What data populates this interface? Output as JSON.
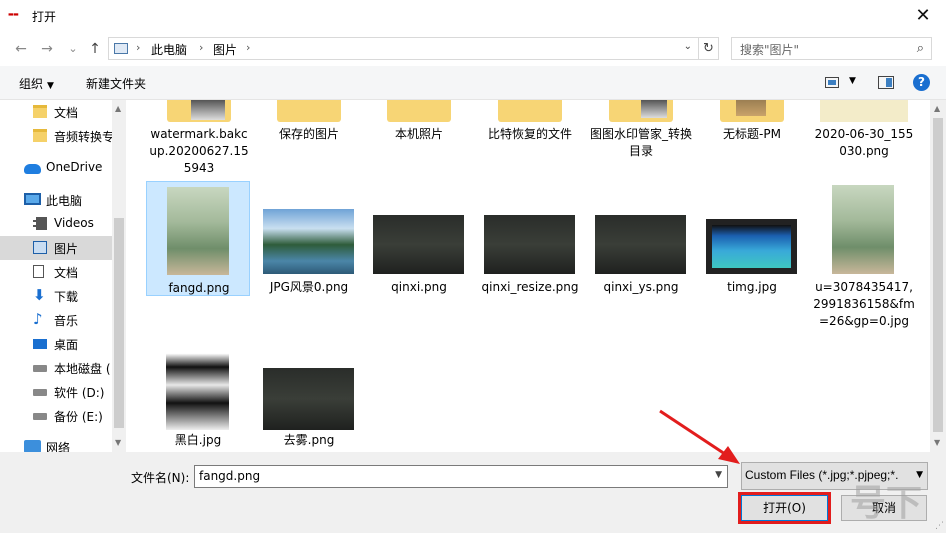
{
  "window": {
    "title": "打开",
    "close_glyph": "✕"
  },
  "nav": {
    "back": "←",
    "forward": "→",
    "recent": "⌄",
    "up": "↑",
    "path": [
      "此电脑",
      "图片"
    ],
    "sep": "›",
    "search_placeholder": "搜索\"图片\""
  },
  "toolbar": {
    "organize": "组织",
    "new_folder": "新建文件夹"
  },
  "sidebar": {
    "items": [
      {
        "label": "文档",
        "icon": "folder-icon"
      },
      {
        "label": "音频转换专",
        "icon": "folder-icon"
      },
      {
        "label": "OneDrive",
        "icon": "onedrive-icon"
      },
      {
        "label": "此电脑",
        "icon": "this-pc-icon"
      },
      {
        "label": "Videos",
        "icon": "videos-icon"
      },
      {
        "label": "图片",
        "icon": "pictures-icon",
        "selected": true
      },
      {
        "label": "文档",
        "icon": "documents-icon"
      },
      {
        "label": "下载",
        "icon": "downloads-icon"
      },
      {
        "label": "音乐",
        "icon": "music-icon"
      },
      {
        "label": "桌面",
        "icon": "desktop-icon"
      },
      {
        "label": "本地磁盘 (",
        "icon": "local-disk-icon"
      },
      {
        "label": "软件 (D:)",
        "icon": "drive-icon"
      },
      {
        "label": "备份 (E:)",
        "icon": "drive-icon"
      },
      {
        "label": "网络",
        "icon": "network-icon"
      }
    ]
  },
  "files": [
    {
      "name": "watermark.bakcup.20200627.155943",
      "kind": "folder"
    },
    {
      "name": "保存的图片",
      "kind": "folder"
    },
    {
      "name": "本机照片",
      "kind": "folder"
    },
    {
      "name": "比特恢复的文件",
      "kind": "folder"
    },
    {
      "name": "图图水印管家_转换目录",
      "kind": "folder"
    },
    {
      "name": "无标题-PM",
      "kind": "folder"
    },
    {
      "name": "2020-06-30_155030.png",
      "kind": "image"
    },
    {
      "name": "fangd.png",
      "kind": "image",
      "selected": true
    },
    {
      "name": "JPG风景0.png",
      "kind": "image"
    },
    {
      "name": "qinxi.png",
      "kind": "image"
    },
    {
      "name": "qinxi_resize.png",
      "kind": "image"
    },
    {
      "name": "qinxi_ys.png",
      "kind": "image"
    },
    {
      "name": "timg.jpg",
      "kind": "image"
    },
    {
      "name": "u=3078435417,2991836158&fm=26&gp=0.jpg",
      "kind": "image"
    },
    {
      "name": "黑白.jpg",
      "kind": "image"
    },
    {
      "name": "去雾.png",
      "kind": "image"
    }
  ],
  "bottom": {
    "filename_label": "文件名(N):",
    "filename_value": "fangd.png",
    "filter_value": "Custom Files (*.jpg;*.pjpeg;*.",
    "open_label": "打开(O)",
    "cancel_label": "取消",
    "watermark_text": "号下"
  }
}
